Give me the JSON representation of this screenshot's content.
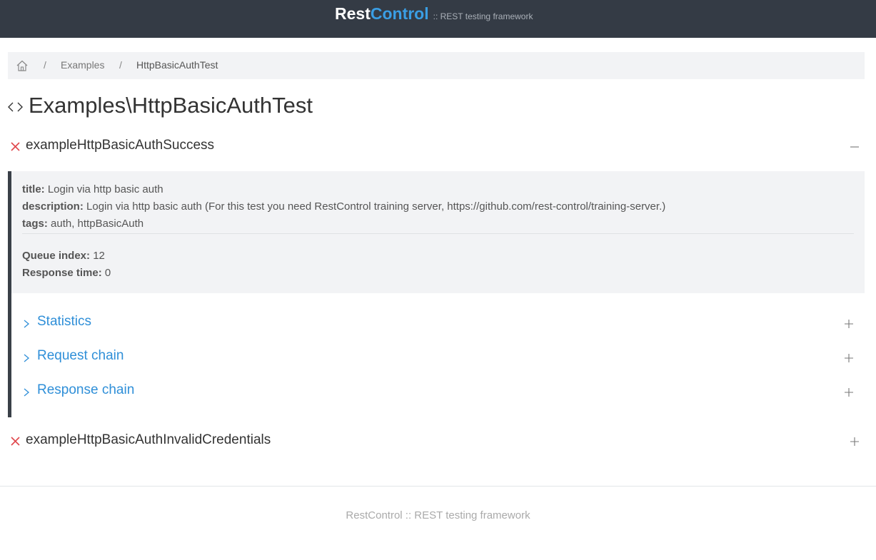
{
  "header": {
    "brand_rest": "Rest",
    "brand_control": "Control",
    "tagline": ":: REST testing framework",
    "accent_color": "#3a9ee4",
    "bar_color": "#343b45"
  },
  "breadcrumb": {
    "home_icon": "home-icon",
    "separator": "/",
    "items": [
      {
        "label": "Examples"
      },
      {
        "label": "HttpBasicAuthTest"
      }
    ]
  },
  "page": {
    "title_icon": "code-icon",
    "title": "Examples\\HttpBasicAuthTest"
  },
  "tests": [
    {
      "name": "exampleHttpBasicAuthSuccess",
      "status_icon": "fail-x-icon",
      "expanded": true,
      "toggle_icon": "minus-icon",
      "meta": {
        "title_key": "title:",
        "title_val": "Login via http basic auth",
        "description_key": "description:",
        "description_val": "Login via http basic auth (For this test you need RestControl training server, https://github.com/rest-control/training-server.)",
        "tags_key": "tags:",
        "tags_val": "auth, httpBasicAuth",
        "queue_key": "Queue index:",
        "queue_val": "12",
        "response_key": "Response time:",
        "response_val": "0"
      },
      "sections": [
        {
          "label": "Statistics"
        },
        {
          "label": "Request chain"
        },
        {
          "label": "Response chain"
        }
      ]
    },
    {
      "name": "exampleHttpBasicAuthInvalidCredentials",
      "status_icon": "fail-x-icon",
      "expanded": false,
      "toggle_icon": "plus-icon"
    }
  ],
  "footer": {
    "text": "RestControl :: REST testing framework"
  }
}
